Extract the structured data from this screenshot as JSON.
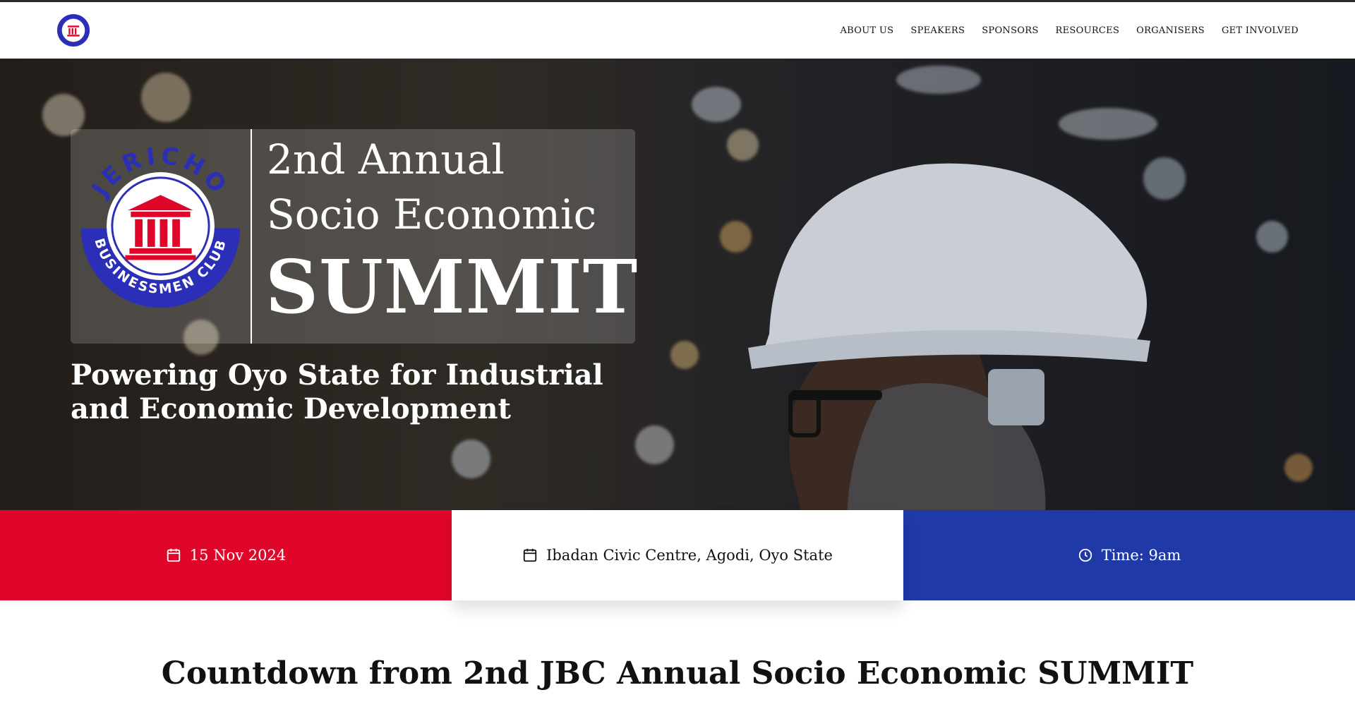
{
  "logo": {
    "arc_top_text": "JERICHO",
    "arc_bottom_text": "BUSINESSMEN CLUB"
  },
  "nav": {
    "items": [
      "ABOUT US",
      "SPEAKERS",
      "SPONSORS",
      "RESOURCES",
      "ORGANISERS",
      "GET INVOLVED"
    ]
  },
  "hero": {
    "title_line1": "2nd Annual",
    "title_line2": "Socio Economic",
    "title_big": "SUMMIT",
    "subtitle": "Powering Oyo State for Industrial and Economic Development"
  },
  "info": {
    "date": "15 Nov 2024",
    "venue": "Ibadan Civic Centre, Agodi, Oyo State",
    "time": "Time: 9am"
  },
  "countdown": {
    "title": "Countdown from 2nd JBC Annual Socio Economic SUMMIT"
  },
  "colors": {
    "red": "#e0062a",
    "blue": "#1f39a8",
    "logo_blue": "#2b2fb8"
  },
  "icons": {
    "date": "calendar-icon",
    "venue": "calendar-icon",
    "time": "clock-icon"
  }
}
